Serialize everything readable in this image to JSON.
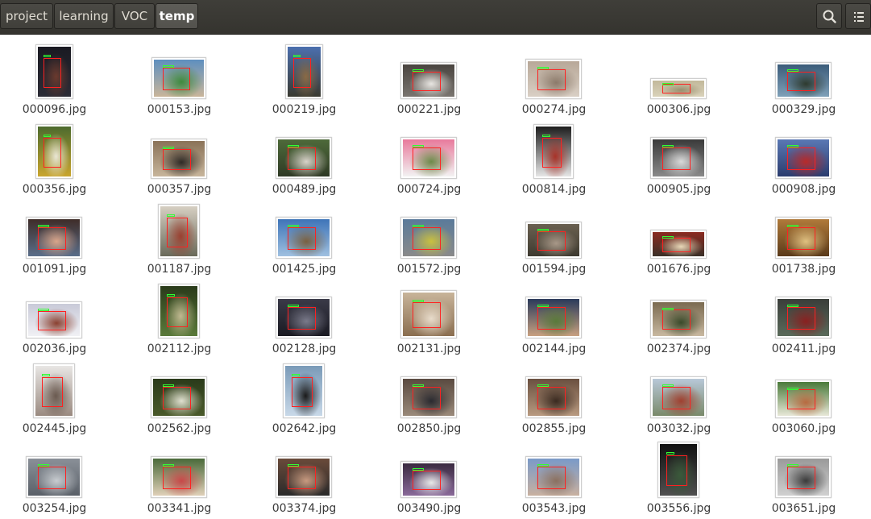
{
  "window": {
    "breadcrumb": [
      {
        "label": "project",
        "active": false
      },
      {
        "label": "learning",
        "active": false
      },
      {
        "label": "VOC",
        "active": false
      },
      {
        "label": "temp",
        "active": true
      }
    ],
    "buttons": [
      {
        "name": "search-button",
        "icon": "search-icon"
      },
      {
        "name": "view-menu-button",
        "icon": "list-view-icon"
      }
    ]
  },
  "files": [
    {
      "name": "000096.jpg",
      "colors": [
        "#1a1a22",
        "#6b3a2e",
        "#2c2c36"
      ]
    },
    {
      "name": "000153.jpg",
      "colors": [
        "#5e8fbf",
        "#3e8a3e",
        "#c9b59a"
      ]
    },
    {
      "name": "000219.jpg",
      "colors": [
        "#4b6fae",
        "#8a6a45",
        "#3a3a30"
      ]
    },
    {
      "name": "000221.jpg",
      "colors": [
        "#4a4540",
        "#e8e6e2",
        "#7a7570"
      ]
    },
    {
      "name": "000274.jpg",
      "colors": [
        "#b8a898",
        "#8c7a6a",
        "#d9cfc4"
      ]
    },
    {
      "name": "000306.jpg",
      "colors": [
        "#c2b89a",
        "#9a8f6e",
        "#d9d2ba"
      ]
    },
    {
      "name": "000329.jpg",
      "colors": [
        "#3b5c7a",
        "#2e3a2e",
        "#7fa0b8"
      ]
    },
    {
      "name": "000356.jpg",
      "colors": [
        "#4d6b2e",
        "#e9e6d5",
        "#c9a52e"
      ]
    },
    {
      "name": "000357.jpg",
      "colors": [
        "#8a7258",
        "#2f2a26",
        "#c7b59b"
      ]
    },
    {
      "name": "000489.jpg",
      "colors": [
        "#4e6a3a",
        "#d8d2c9",
        "#2f3a25"
      ]
    },
    {
      "name": "000724.jpg",
      "colors": [
        "#e87a9c",
        "#6e8a4a",
        "#f2f2f2"
      ]
    },
    {
      "name": "000814.jpg",
      "colors": [
        "#1d1d1d",
        "#a83228",
        "#e6e6e6"
      ]
    },
    {
      "name": "000905.jpg",
      "colors": [
        "#3a3a3a",
        "#d9d9d9",
        "#8a8a8a"
      ]
    },
    {
      "name": "000908.jpg",
      "colors": [
        "#5a78b4",
        "#b82a2a",
        "#2b3c6e"
      ]
    },
    {
      "name": "001091.jpg",
      "colors": [
        "#3e2c28",
        "#d9a58a",
        "#5a6e8a"
      ]
    },
    {
      "name": "001187.jpg",
      "colors": [
        "#d6cfc2",
        "#9a4030",
        "#6a6a5a"
      ]
    },
    {
      "name": "001425.jpg",
      "colors": [
        "#3e74b8",
        "#7a6040",
        "#9fc0e0"
      ]
    },
    {
      "name": "001572.jpg",
      "colors": [
        "#5a7a9a",
        "#c8c040",
        "#8a8a8a"
      ]
    },
    {
      "name": "001594.jpg",
      "colors": [
        "#6a6050",
        "#a89888",
        "#3e3a30"
      ]
    },
    {
      "name": "001676.jpg",
      "colors": [
        "#8a2a20",
        "#e8d8b8",
        "#3a3028"
      ]
    },
    {
      "name": "001738.jpg",
      "colors": [
        "#b07a3a",
        "#e0c080",
        "#5a3a1a"
      ]
    },
    {
      "name": "002036.jpg",
      "colors": [
        "#c8cad8",
        "#8a4030",
        "#f0f0f4"
      ]
    },
    {
      "name": "002112.jpg",
      "colors": [
        "#2a3a1a",
        "#c0b890",
        "#5a7a3a"
      ]
    },
    {
      "name": "002128.jpg",
      "colors": [
        "#3a3a48",
        "#7a7a8a",
        "#1a1a22"
      ]
    },
    {
      "name": "002131.jpg",
      "colors": [
        "#c8b49a",
        "#e8dccb",
        "#8a6e50"
      ]
    },
    {
      "name": "002144.jpg",
      "colors": [
        "#2a3a5a",
        "#5a7a3a",
        "#c8a080"
      ]
    },
    {
      "name": "002374.jpg",
      "colors": [
        "#7a6a50",
        "#3a4a2a",
        "#c8b8a0"
      ]
    },
    {
      "name": "002411.jpg",
      "colors": [
        "#3a3e3a",
        "#8a2020",
        "#5a6a5a"
      ]
    },
    {
      "name": "002445.jpg",
      "colors": [
        "#e8e6e4",
        "#6a5a50",
        "#9a8a80"
      ]
    },
    {
      "name": "002562.jpg",
      "colors": [
        "#2a3a1a",
        "#e0e0d0",
        "#4a5a2a"
      ]
    },
    {
      "name": "002642.jpg",
      "colors": [
        "#7a9ab8",
        "#1a1a1a",
        "#c8d8e8"
      ]
    },
    {
      "name": "002850.jpg",
      "colors": [
        "#5a4a40",
        "#2a2a30",
        "#9a8a7a"
      ]
    },
    {
      "name": "002855.jpg",
      "colors": [
        "#6a5040",
        "#3a2a20",
        "#b89a80"
      ]
    },
    {
      "name": "003032.jpg",
      "colors": [
        "#b8c8d8",
        "#a04030",
        "#7a8a6a"
      ]
    },
    {
      "name": "003060.jpg",
      "colors": [
        "#4a7a3a",
        "#b86a40",
        "#e8e8d8"
      ]
    },
    {
      "name": "003254.jpg",
      "colors": [
        "#8a9098",
        "#c8ccd0",
        "#5a6068"
      ]
    },
    {
      "name": "003341.jpg",
      "colors": [
        "#4a6a3a",
        "#c84848",
        "#e0d0b8"
      ]
    },
    {
      "name": "003374.jpg",
      "colors": [
        "#6a4a3a",
        "#c89a80",
        "#2a2a2a"
      ]
    },
    {
      "name": "003490.jpg",
      "colors": [
        "#3a2a40",
        "#e8e8e8",
        "#8a6a9a"
      ]
    },
    {
      "name": "003543.jpg",
      "colors": [
        "#7a9ac8",
        "#8a7060",
        "#c8b0a0"
      ]
    },
    {
      "name": "003556.jpg",
      "colors": [
        "#101010",
        "#3a5a3a",
        "#505050"
      ]
    },
    {
      "name": "003651.jpg",
      "colors": [
        "#9a9a9a",
        "#3a3a3a",
        "#d0d0d0"
      ]
    }
  ]
}
